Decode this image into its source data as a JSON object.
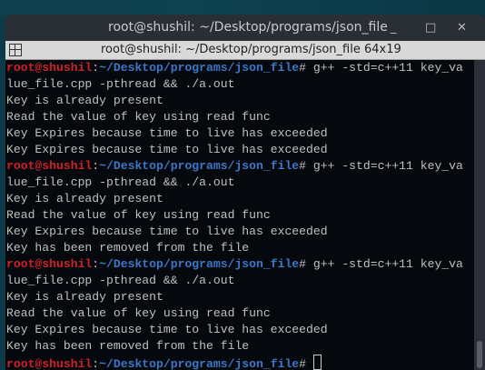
{
  "window": {
    "title": "root@shushil: ~/Desktop/programs/json_file",
    "minimize": "_",
    "maximize": "□",
    "close": "✕"
  },
  "tab": {
    "title": "root@shushil: ~/Desktop/programs/json_file 64x19"
  },
  "prompt": {
    "user": "root@shushil",
    "path": "~/Desktop/programs/json_file",
    "symbol": "# "
  },
  "lines": [
    {
      "type": "prompt",
      "cmd": "g++ -std=c++11 key_va"
    },
    {
      "type": "out",
      "text": "lue_file.cpp -pthread && ./a.out"
    },
    {
      "type": "out",
      "text": "Key is already present"
    },
    {
      "type": "out",
      "text": "Read the value of key using read func"
    },
    {
      "type": "out",
      "text": "Key Expires because time to live has exceeded"
    },
    {
      "type": "out",
      "text": "Key Expires because time to live has exceeded"
    },
    {
      "type": "prompt",
      "cmd": "g++ -std=c++11 key_va"
    },
    {
      "type": "out",
      "text": "lue_file.cpp -pthread && ./a.out"
    },
    {
      "type": "out",
      "text": "Key is already present"
    },
    {
      "type": "out",
      "text": "Read the value of key using read func"
    },
    {
      "type": "out",
      "text": "Key Expires because time to live has exceeded"
    },
    {
      "type": "out",
      "text": "Key has been removed from the file"
    },
    {
      "type": "prompt",
      "cmd": "g++ -std=c++11 key_va"
    },
    {
      "type": "out",
      "text": "lue_file.cpp -pthread && ./a.out"
    },
    {
      "type": "out",
      "text": "Key is already present"
    },
    {
      "type": "out",
      "text": "Read the value of key using read func"
    },
    {
      "type": "out",
      "text": "Key Expires because time to live has exceeded"
    },
    {
      "type": "out",
      "text": "Key has been removed from the file"
    },
    {
      "type": "prompt",
      "cmd": ""
    }
  ]
}
